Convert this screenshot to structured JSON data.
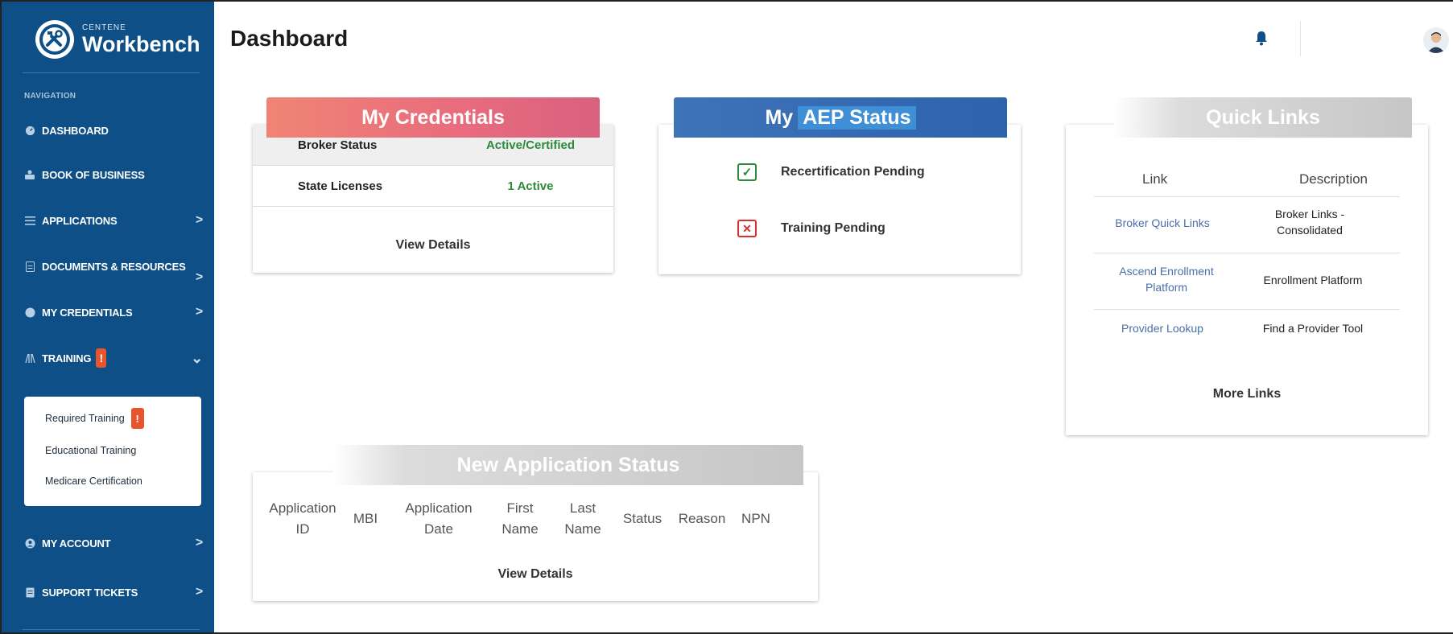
{
  "brand": {
    "small": "CENTENE",
    "name": "Workbench"
  },
  "sidebar": {
    "heading": "NAVIGATION",
    "items": [
      {
        "label": "DASHBOARD",
        "icon": "gauge-icon"
      },
      {
        "label": "BOOK OF BUSINESS",
        "icon": "people-icon"
      },
      {
        "label": "APPLICATIONS",
        "icon": "list-icon",
        "chevron": ">"
      },
      {
        "label": "DOCUMENTS & RESOURCES",
        "icon": "document-icon",
        "chevron": ">"
      },
      {
        "label": "MY CREDENTIALS",
        "icon": "badge-icon",
        "chevron": ">"
      },
      {
        "label": "TRAINING",
        "icon": "book-icon",
        "chevron": "⌄",
        "badge": "!"
      },
      {
        "label": "MY ACCOUNT",
        "icon": "user-circle-icon",
        "chevron": ">"
      },
      {
        "label": "SUPPORT TICKETS",
        "icon": "ticket-icon",
        "chevron": ">"
      }
    ],
    "training_sub": [
      {
        "label": "Required Training",
        "badge": "!"
      },
      {
        "label": "Educational Training"
      },
      {
        "label": "Medicare Certification"
      }
    ]
  },
  "header": {
    "title": "Dashboard"
  },
  "credentials": {
    "title": "My Credentials",
    "rows": [
      {
        "label": "Broker Status",
        "value": "Active/Certified"
      },
      {
        "label": "State Licenses",
        "value": "1 Active"
      }
    ],
    "action": "View Details"
  },
  "aep": {
    "title_prefix": "My",
    "title_highlight": "AEP Status",
    "items": [
      {
        "label": "Recertification Pending",
        "state": "checked"
      },
      {
        "label": "Training Pending",
        "state": "failed"
      }
    ]
  },
  "quick_links": {
    "title": "Quick Links",
    "col_link": "Link",
    "col_desc": "Description",
    "rows": [
      {
        "link": "Broker Quick Links",
        "desc": "Broker Links - Consolidated"
      },
      {
        "link": "Ascend Enrollment Platform",
        "desc": "Enrollment Platform"
      },
      {
        "link": "Provider Lookup",
        "desc": "Find a Provider Tool"
      }
    ],
    "more": "More Links"
  },
  "new_app_status": {
    "title": "New Application Status",
    "columns": [
      "Application ID",
      "MBI",
      "Application Date",
      "First Name",
      "Last Name",
      "Status",
      "Reason",
      "NPN"
    ],
    "action": "View Details"
  },
  "colors": {
    "sidebar_bg": "#0d4f86",
    "credentials_tab": "#e86b7e",
    "aep_tab": "#2d63ad",
    "status_green": "#2c8a3a",
    "status_red": "#d9302c",
    "link_blue": "#4a6fa8",
    "badge_orange": "#e8542c"
  }
}
